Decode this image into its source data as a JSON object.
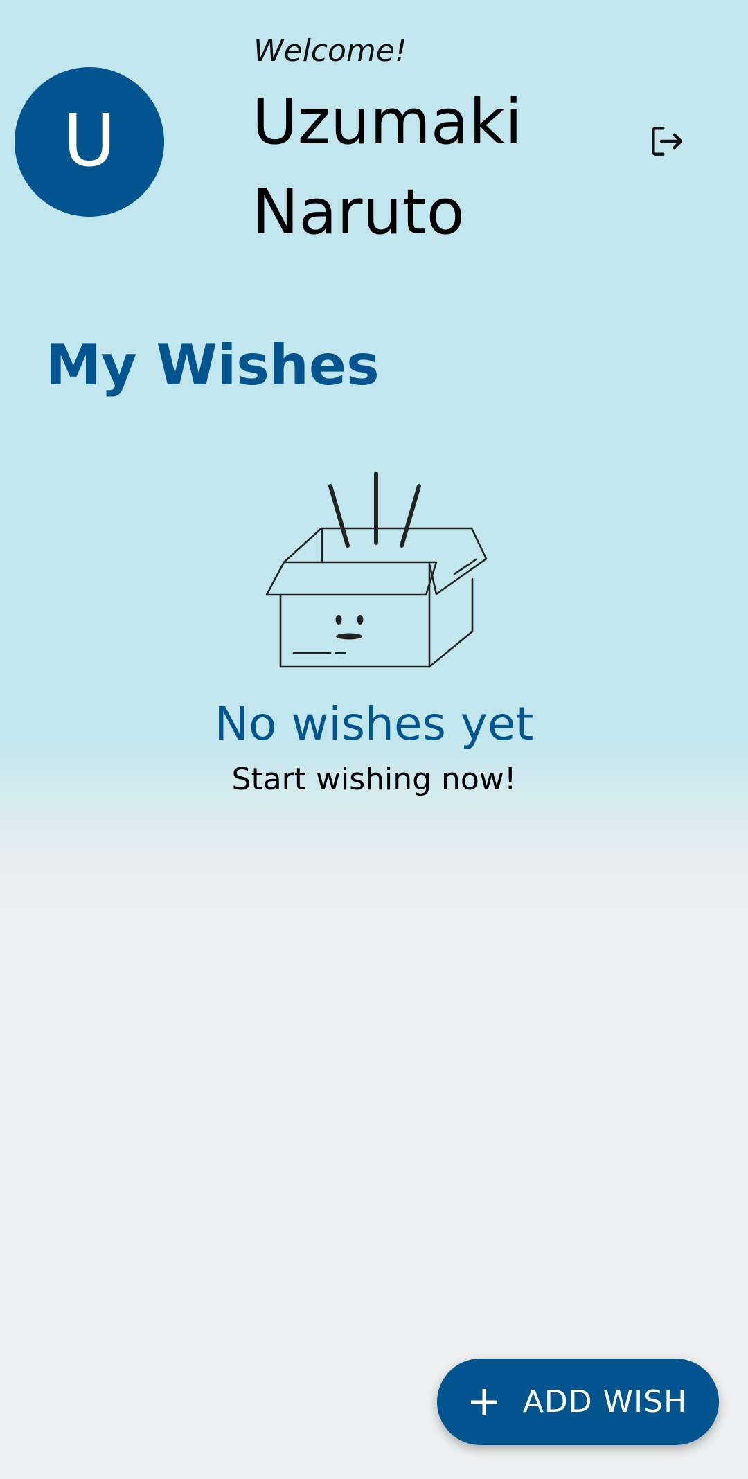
{
  "header": {
    "avatar_initial": "U",
    "welcome_text": "Welcome!",
    "user_name": "Uzumaki Naruto",
    "logout_icon": "logout-icon"
  },
  "wishes": {
    "section_title": "My Wishes",
    "empty_illustration": "empty-box-illustration",
    "empty_title": "No wishes yet",
    "empty_subtitle": "Start wishing now!"
  },
  "fab": {
    "icon": "plus-icon",
    "label": "ADD WISH"
  },
  "colors": {
    "primary": "#02558f",
    "background_top": "#c2e6ee",
    "background_bottom": "#eeeff0",
    "on_primary": "#ffffff"
  }
}
